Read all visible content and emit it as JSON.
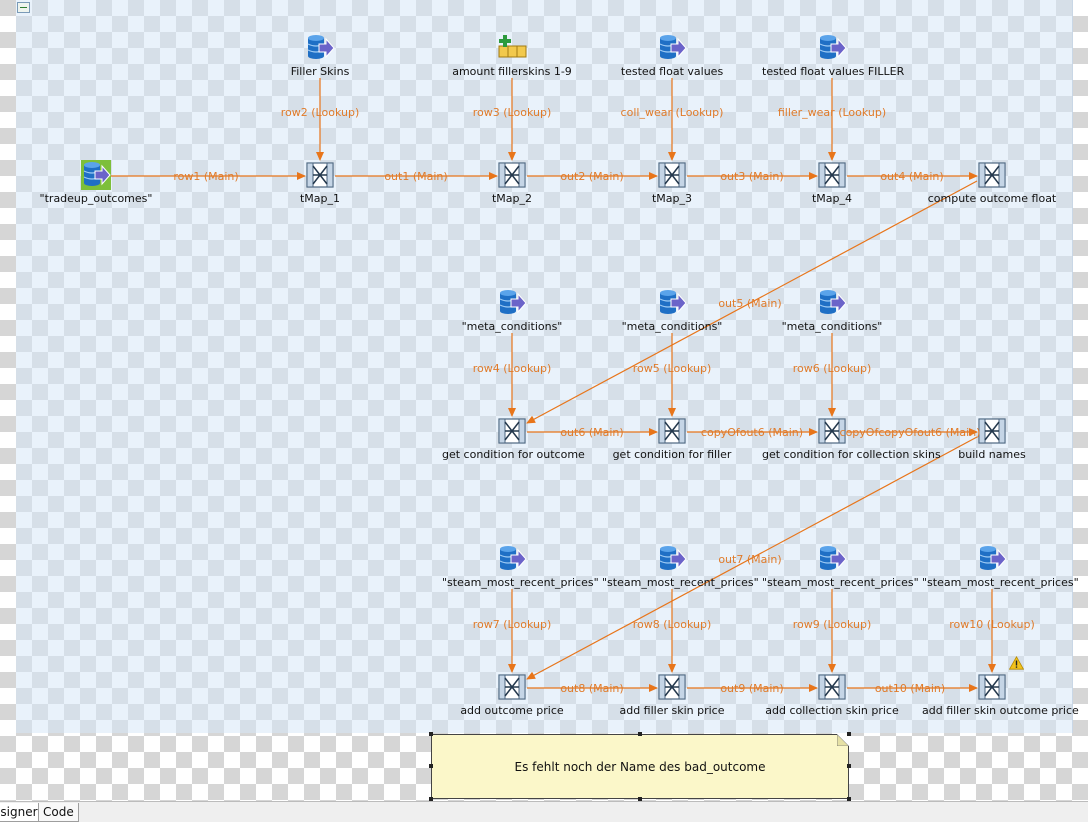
{
  "colors": {
    "link": "#e8751a",
    "link_label": "#e07b2a",
    "db_icon": "#1f6fc5",
    "arrow_icon": "#6b63c9",
    "start_highlight": "#7dbf3a",
    "note_bg": "#fbf7c9"
  },
  "components": [
    {
      "id": "tradeup_outcomes",
      "label": "\"tradeup_outcomes\"",
      "type": "db-input-start"
    },
    {
      "id": "filler_skins",
      "label": "Filler Skins",
      "type": "db-input"
    },
    {
      "id": "amount_fillerskins",
      "label": "amount fillerskins 1-9",
      "type": "row-generator"
    },
    {
      "id": "tested_float_values",
      "label": "tested float values",
      "type": "db-input"
    },
    {
      "id": "tested_float_values_filler",
      "label": "tested float values FILLER",
      "type": "db-input"
    },
    {
      "id": "tmap_1",
      "label": "tMap_1",
      "type": "tmap"
    },
    {
      "id": "tmap_2",
      "label": "tMap_2",
      "type": "tmap"
    },
    {
      "id": "tmap_3",
      "label": "tMap_3",
      "type": "tmap"
    },
    {
      "id": "tmap_4",
      "label": "tMap_4",
      "type": "tmap"
    },
    {
      "id": "compute_outcome_float",
      "label": "compute outcome float",
      "type": "tmap"
    },
    {
      "id": "meta_conditions_1",
      "label": "\"meta_conditions\"",
      "type": "db-input"
    },
    {
      "id": "meta_conditions_2",
      "label": "\"meta_conditions\"",
      "type": "db-input"
    },
    {
      "id": "meta_conditions_3",
      "label": "\"meta_conditions\"",
      "type": "db-input"
    },
    {
      "id": "get_condition_outcome",
      "label": "get condition for outcome",
      "type": "tmap"
    },
    {
      "id": "get_condition_filler",
      "label": "get condition for filler",
      "type": "tmap"
    },
    {
      "id": "get_condition_collection",
      "label": "get condition for collection skins",
      "type": "tmap"
    },
    {
      "id": "build_names",
      "label": "build names",
      "type": "tmap"
    },
    {
      "id": "steam_prices_1",
      "label": "\"steam_most_recent_prices\"",
      "type": "db-input"
    },
    {
      "id": "steam_prices_2",
      "label": "\"steam_most_recent_prices\"",
      "type": "db-input"
    },
    {
      "id": "steam_prices_3",
      "label": "\"steam_most_recent_prices\"",
      "type": "db-input"
    },
    {
      "id": "steam_prices_4",
      "label": "\"steam_most_recent_prices\"",
      "type": "db-input"
    },
    {
      "id": "add_outcome_price",
      "label": "add outcome price",
      "type": "tmap"
    },
    {
      "id": "add_filler_skin_price",
      "label": "add filler skin price",
      "type": "tmap"
    },
    {
      "id": "add_collection_skin_price",
      "label": "add collection skin price",
      "type": "tmap"
    },
    {
      "id": "add_filler_skin_outcome_price",
      "label": "add filler skin outcome price",
      "type": "tmap",
      "warning": true
    }
  ],
  "links": [
    {
      "label": "row1 (Main)",
      "from": "tradeup_outcomes",
      "to": "tmap_1"
    },
    {
      "label": "row2 (Lookup)",
      "from": "filler_skins",
      "to": "tmap_1"
    },
    {
      "label": "out1 (Main)",
      "from": "tmap_1",
      "to": "tmap_2"
    },
    {
      "label": "row3 (Lookup)",
      "from": "amount_fillerskins",
      "to": "tmap_2"
    },
    {
      "label": "out2 (Main)",
      "from": "tmap_2",
      "to": "tmap_3"
    },
    {
      "label": "coll_wear (Lookup)",
      "from": "tested_float_values",
      "to": "tmap_3"
    },
    {
      "label": "out3 (Main)",
      "from": "tmap_3",
      "to": "tmap_4"
    },
    {
      "label": "filler_wear (Lookup)",
      "from": "tested_float_values_filler",
      "to": "tmap_4"
    },
    {
      "label": "out4 (Main)",
      "from": "tmap_4",
      "to": "compute_outcome_float"
    },
    {
      "label": "out5 (Main)",
      "from": "compute_outcome_float",
      "to": "get_condition_outcome"
    },
    {
      "label": "row4 (Lookup)",
      "from": "meta_conditions_1",
      "to": "get_condition_outcome"
    },
    {
      "label": "out6 (Main)",
      "from": "get_condition_outcome",
      "to": "get_condition_filler"
    },
    {
      "label": "row5 (Lookup)",
      "from": "meta_conditions_2",
      "to": "get_condition_filler"
    },
    {
      "label": "copyOfout6 (Main)",
      "from": "get_condition_filler",
      "to": "get_condition_collection"
    },
    {
      "label": "row6 (Lookup)",
      "from": "meta_conditions_3",
      "to": "get_condition_collection"
    },
    {
      "label": "copyOfcopyOfout6 (Main)",
      "from": "get_condition_collection",
      "to": "build_names"
    },
    {
      "label": "out7 (Main)",
      "from": "build_names",
      "to": "add_outcome_price"
    },
    {
      "label": "row7 (Lookup)",
      "from": "steam_prices_1",
      "to": "add_outcome_price"
    },
    {
      "label": "out8 (Main)",
      "from": "add_outcome_price",
      "to": "add_filler_skin_price"
    },
    {
      "label": "row8 (Lookup)",
      "from": "steam_prices_2",
      "to": "add_filler_skin_price"
    },
    {
      "label": "out9 (Main)",
      "from": "add_filler_skin_price",
      "to": "add_collection_skin_price"
    },
    {
      "label": "row9 (Lookup)",
      "from": "steam_prices_3",
      "to": "add_collection_skin_price"
    },
    {
      "label": "out10 (Main)",
      "from": "add_collection_skin_price",
      "to": "add_filler_skin_outcome_price"
    },
    {
      "label": "row10 (Lookup)",
      "from": "steam_prices_4",
      "to": "add_filler_skin_outcome_price"
    }
  ],
  "note": {
    "text": "Es fehlt noch der Name des bad_outcome"
  },
  "tabs": [
    {
      "label": "esigner",
      "active": true
    },
    {
      "label": "Code",
      "active": false
    }
  ]
}
